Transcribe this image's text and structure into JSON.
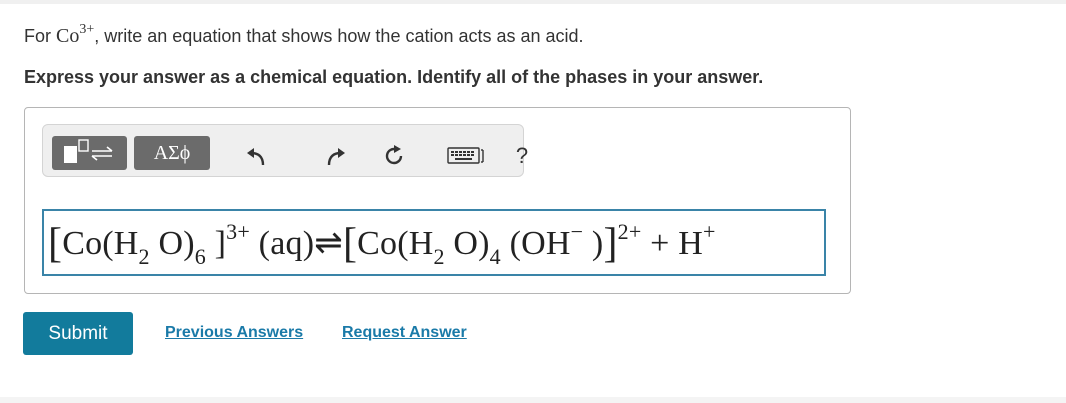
{
  "prompt": {
    "before": "For ",
    "species": "Co",
    "charge": "3+",
    "after": ", write an equation that shows how the cation acts as an acid."
  },
  "instruction": "Express your answer as a chemical equation. Identify all of the phases in your answer.",
  "toolbar": {
    "symbols_label": "ΑΣϕ",
    "help_label": "?",
    "icons": [
      "templates-icon",
      "undo-icon",
      "redo-icon",
      "reset-icon",
      "keyboard-icon",
      "help-icon"
    ]
  },
  "answer": {
    "lbr1": "[",
    "co1": "Co(H",
    "sub1": "2",
    "o1": " O)",
    "sub2": "6",
    "rbr1": " ]",
    "sup1": "3+",
    "aq": " (aq)",
    "arrow": "⇌",
    "lbr2": "[",
    "co2": "Co(H",
    "sub3": "2",
    "o2": " O)",
    "sub4": "4",
    "oh": " (OH",
    "sup2": "−",
    "cp": " )",
    "rbr2": "]",
    "sup3": "2+",
    "plus": " + H",
    "sup4": "+"
  },
  "actions": {
    "submit": "Submit",
    "previous_answers": "Previous Answers",
    "request_answer": "Request Answer"
  },
  "colors": {
    "button": "#127b9c",
    "link": "#1a7aa8",
    "field_border": "#3a84a8",
    "toolbar_button": "#6b6b6b"
  }
}
